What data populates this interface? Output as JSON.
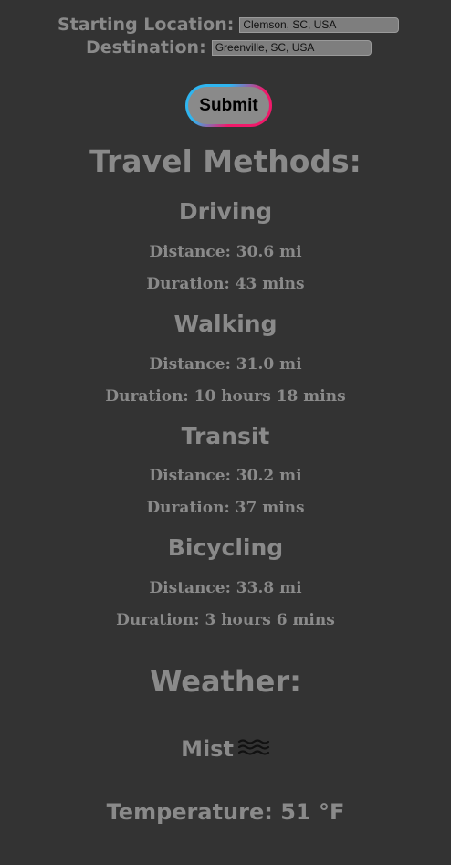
{
  "form": {
    "start_label": "Starting Location:",
    "start_value": "Clemson, SC, USA",
    "dest_label": "Destination:",
    "dest_value": "Greenville, SC, USA",
    "submit_label": "Submit"
  },
  "travel": {
    "heading": "Travel Methods:",
    "methods": [
      {
        "name": "Driving",
        "distance": "Distance: 30.6 mi",
        "duration": "Duration: 43 mins"
      },
      {
        "name": "Walking",
        "distance": "Distance: 31.0 mi",
        "duration": "Duration: 10 hours 18 mins"
      },
      {
        "name": "Transit",
        "distance": "Distance: 30.2 mi",
        "duration": "Duration: 37 mins"
      },
      {
        "name": "Bicycling",
        "distance": "Distance: 33.8 mi",
        "duration": "Duration: 3 hours 6 mins"
      }
    ]
  },
  "weather": {
    "heading": "Weather:",
    "condition": "Mist",
    "condition_icon": "mist-icon",
    "temperature": "Temperature: 51 °F"
  },
  "colors": {
    "background": "#333333",
    "text": "#8a8a8a",
    "button_gradient_start": "#2fb5f0",
    "button_gradient_end": "#f0196a"
  }
}
